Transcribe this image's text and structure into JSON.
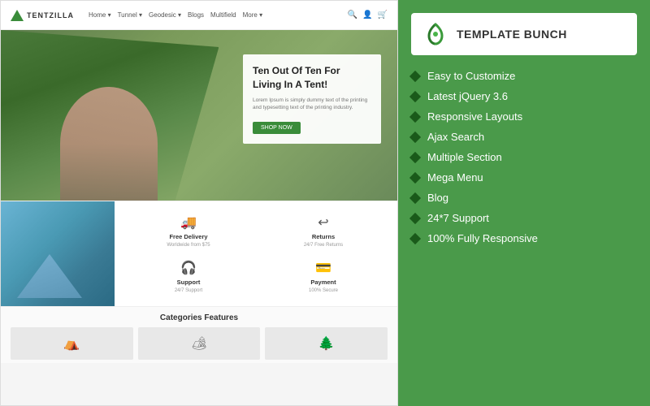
{
  "left": {
    "navbar": {
      "logo_text": "TENTZILLA",
      "links": [
        "Home ▾",
        "Tunnel ▾",
        "Geodesic ▾",
        "Blogs",
        "Multifield",
        "More ▾"
      ]
    },
    "hero": {
      "title": "Ten Out Of Ten For Living In A Tent!",
      "description": "Lorem Ipsum is simply dummy text of the printing and typesetting text of the printing industry.",
      "button_label": "SHOP NOW"
    },
    "features": [
      {
        "icon": "🚚",
        "title": "Free Delivery",
        "sub": "Worldwide from $75"
      },
      {
        "icon": "↩",
        "title": "Returns",
        "sub": "24/7 Free Returns"
      },
      {
        "icon": "🎧",
        "title": "Support",
        "sub": "24/7 Support"
      },
      {
        "icon": "💳",
        "title": "Payment",
        "sub": "100% Secure"
      }
    ],
    "categories_title": "Categories Features",
    "categories": [
      "⛺",
      "🏕",
      "🌲"
    ]
  },
  "right": {
    "brand_name": "TEMPLATE BUNCH",
    "features": [
      "Easy to Customize",
      "Latest jQuery 3.6",
      "Responsive Layouts",
      "Ajax Search",
      "Multiple Section",
      "Mega Menu",
      "Blog",
      "24*7 Support",
      "100% Fully Responsive"
    ]
  }
}
